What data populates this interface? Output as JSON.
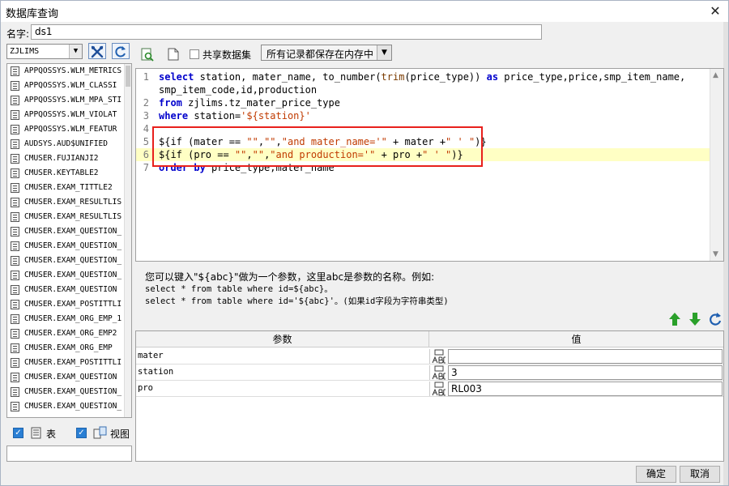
{
  "window": {
    "title": "数据库查询",
    "close_glyph": "✕"
  },
  "name_field": {
    "label": "名字:",
    "value": "ds1"
  },
  "db_select": {
    "value": "ZJLIMS"
  },
  "objects": [
    "APPQOSSYS.WLM_METRICS",
    "APPQOSSYS.WLM_CLASSI",
    "APPQOSSYS.WLM_MPA_STI",
    "APPQOSSYS.WLM_VIOLAT",
    "APPQOSSYS.WLM_FEATUR",
    "AUDSYS.AUD$UNIFIED",
    "CMUSER.FUJIANJI2",
    "CMUSER.KEYTABLE2",
    "CMUSER.EXAM_TITTLE2",
    "CMUSER.EXAM_RESULTLIS",
    "CMUSER.EXAM_RESULTLIS",
    "CMUSER.EXAM_QUESTION_",
    "CMUSER.EXAM_QUESTION_",
    "CMUSER.EXAM_QUESTION_",
    "CMUSER.EXAM_QUESTION_",
    "CMUSER.EXAM_QUESTION",
    "CMUSER.EXAM_POSTITTLI",
    "CMUSER.EXAM_ORG_EMP_1",
    "CMUSER.EXAM_ORG_EMP2",
    "CMUSER.EXAM_ORG_EMP",
    "CMUSER.EXAM_POSTITTLI",
    "CMUSER.EXAM_QUESTION",
    "CMUSER.EXAM_QUESTION_",
    "CMUSER.EXAM_QUESTION_"
  ],
  "filters": {
    "table_label": "表",
    "view_label": "视图"
  },
  "toolbar": {
    "share_label": "共享数据集",
    "memory_option": "所有记录都保存在内存中"
  },
  "sql": {
    "line_numbers": [
      "1",
      "",
      "2",
      "3",
      "4",
      "5",
      "6",
      "7"
    ],
    "lines": [
      [
        {
          "t": "select",
          "c": "kw"
        },
        {
          "t": " station, mater_name, to_number("
        },
        {
          "t": "trim",
          "c": "fn"
        },
        {
          "t": "(price_type)) "
        },
        {
          "t": "as",
          "c": "kw"
        },
        {
          "t": " price_type,price,smp_item_name,"
        }
      ],
      [
        {
          "t": "smp_item_code,id,production"
        }
      ],
      [
        {
          "t": "from",
          "c": "kw"
        },
        {
          "t": " zjlims.tz_mater_price_type"
        }
      ],
      [
        {
          "t": "where",
          "c": "kw"
        },
        {
          "t": " station="
        },
        {
          "t": "'${station}'",
          "c": "str"
        }
      ],
      [],
      [
        {
          "t": "${if (mater == "
        },
        {
          "t": "\"\"",
          "c": "str"
        },
        {
          "t": ","
        },
        {
          "t": "\"\"",
          "c": "str"
        },
        {
          "t": ","
        },
        {
          "t": "\"and mater_name='\"",
          "c": "str"
        },
        {
          "t": " + mater +"
        },
        {
          "t": "\" ' \"",
          "c": "str"
        },
        {
          "t": ")}"
        }
      ],
      [
        {
          "t": "${if (pro == "
        },
        {
          "t": "\"\"",
          "c": "str"
        },
        {
          "t": ","
        },
        {
          "t": "\"\"",
          "c": "str"
        },
        {
          "t": ","
        },
        {
          "t": "\"and production='\"",
          "c": "str"
        },
        {
          "t": " + pro +"
        },
        {
          "t": "\" ' \"",
          "c": "str"
        },
        {
          "t": ")}"
        }
      ],
      [
        {
          "t": "order by",
          "c": "kw"
        },
        {
          "t": " price_type,mater_name"
        }
      ]
    ]
  },
  "hint": {
    "line1": "您可以键入\"${abc}\"做为一个参数，这里abc是参数的名称。例如:",
    "line2": "select * from table where id=${abc}。",
    "line3": "select * from table where id='${abc}'。(如果id字段为字符串类型)"
  },
  "params": {
    "col_name": "参数",
    "col_value": "值",
    "rows": [
      {
        "name": "mater",
        "value": ""
      },
      {
        "name": "station",
        "value": "3"
      },
      {
        "name": "pro",
        "value": "RL003"
      }
    ]
  },
  "buttons": {
    "ok": "确定",
    "cancel": "取消"
  }
}
